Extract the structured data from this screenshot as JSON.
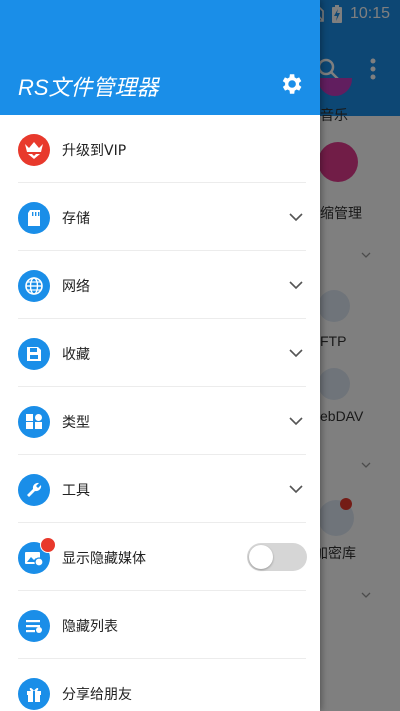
{
  "status_bar": {
    "time": "10:15",
    "icons": [
      "wifi-icon",
      "no-sim-icon",
      "battery-charging-icon"
    ]
  },
  "drawer": {
    "title": "RS文件管理器",
    "settings_icon": "gear-icon",
    "items": [
      {
        "label": "升级到VIP",
        "icon": "vip-crown-icon",
        "chevron": false
      },
      {
        "label": "存储",
        "icon": "sd-card-icon",
        "chevron": true
      },
      {
        "label": "网络",
        "icon": "globe-icon",
        "chevron": true
      },
      {
        "label": "收藏",
        "icon": "save-icon",
        "chevron": true
      },
      {
        "label": "类型",
        "icon": "category-icon",
        "chevron": true
      },
      {
        "label": "工具",
        "icon": "wrench-icon",
        "chevron": true
      },
      {
        "label": "显示隐藏媒体",
        "icon": "hidden-media-icon",
        "toggle": false
      },
      {
        "label": "隐藏列表",
        "icon": "hidden-list-icon",
        "chevron": false
      },
      {
        "label": "分享给朋友",
        "icon": "gift-icon",
        "chevron": false
      }
    ]
  },
  "background": {
    "items": [
      "音乐",
      "缩管理",
      "FTP",
      "ebDAV",
      "加密库"
    ]
  },
  "colors": {
    "accent": "#1a8ee8",
    "vip": "#e8392c",
    "scrim": "rgba(0,0,0,0.5)"
  }
}
